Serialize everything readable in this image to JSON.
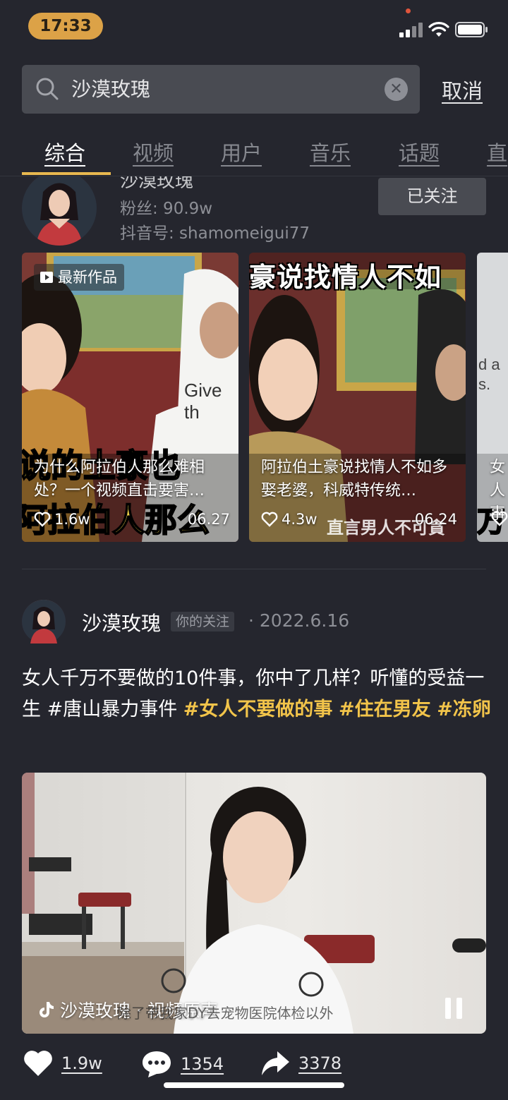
{
  "status_bar": {
    "time": "17:33"
  },
  "search": {
    "query": "沙漠玫瑰",
    "cancel_label": "取消"
  },
  "tabs": [
    {
      "label": "综合",
      "active": true
    },
    {
      "label": "视频",
      "active": false
    },
    {
      "label": "用户",
      "active": false
    },
    {
      "label": "音乐",
      "active": false
    },
    {
      "label": "话题",
      "active": false
    },
    {
      "label": "直",
      "active": false
    }
  ],
  "user_card": {
    "name": "沙漠玫瑰",
    "followers": "粉丝: 90.9w",
    "douyin_id": "抖音号: shamomeigui77",
    "follow_button": "已关注"
  },
  "thumbnails": [
    {
      "badge": "最新作品",
      "caption": "为什么阿拉伯人那么难相处？一个视频直击要害…",
      "likes": "1.6w",
      "date": "06.27",
      "overlay_text": "Give th"
    },
    {
      "banner": "豪说找情人不如",
      "caption": "阿拉伯土豪说找情人不如多娶老婆，科威特传统…",
      "likes": "4.3w",
      "date": "06.24"
    },
    {
      "caption": "女人事",
      "overlay_text": "d a s."
    }
  ],
  "post": {
    "author": "沙漠玫瑰",
    "relation_tag": "你的关注",
    "date": "· 2022.6.16",
    "text_plain": "女人千万不要做的10件事，你中了几样？听懂的受益一生 #唐山暴力事件 ",
    "hashtag_1": "#女人不要做的事",
    "hashtag_2": "#住在男友",
    "hashtag_3": "#冻卵",
    "video_caption": "沙漠玫瑰 · 视频原声",
    "subtitle": "除了带我家DY去宠物医院体检以外",
    "likes": "1.9w",
    "comments": "1354",
    "shares": "3378"
  },
  "icons": [
    "search-icon",
    "clear-icon",
    "heart-icon",
    "comment-icon",
    "share-icon",
    "play-icon",
    "pause-icon",
    "douyin-icon",
    "wifi-icon",
    "battery-icon",
    "signal-icon"
  ],
  "colors": {
    "background": "#25262e",
    "accent": "#e8b84f",
    "hashtag": "#f2c44a",
    "time_pill": "#dca247"
  }
}
